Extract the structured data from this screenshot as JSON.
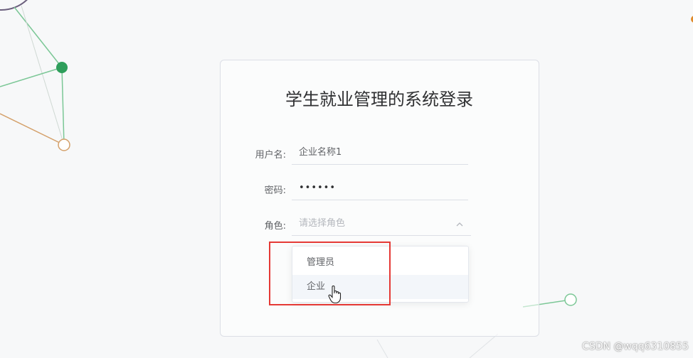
{
  "login": {
    "title": "学生就业管理的系统登录",
    "username_label": "用户名:",
    "username_value": "企业名称1",
    "password_label": "密码:",
    "password_value": "••••••",
    "role_label": "角色:",
    "role_placeholder": "请选择角色"
  },
  "role_options": [
    "管理员",
    "企业"
  ],
  "watermark": "CSDN @wqq6310855",
  "colors": {
    "highlight": "#e53935",
    "node_green": "#2e9e5b",
    "line_orange": "#d4a06a"
  },
  "icons": {
    "select_arrow": "chevron-up-icon",
    "pointer": "hand-cursor-icon"
  }
}
